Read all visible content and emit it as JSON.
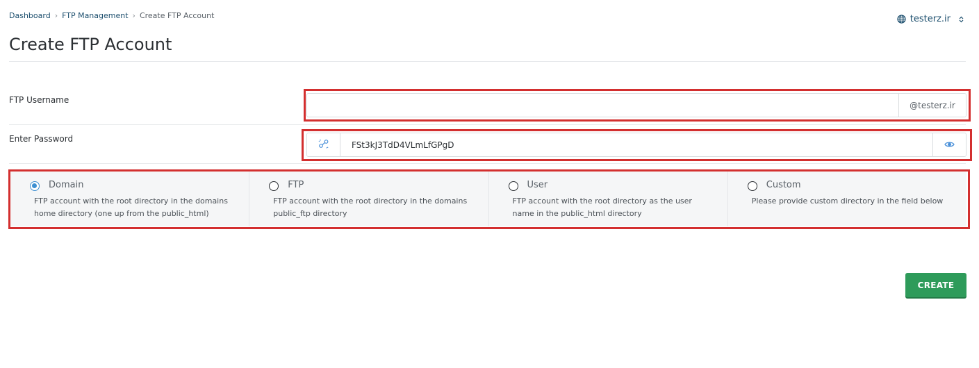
{
  "breadcrumb": {
    "items": [
      "Dashboard",
      "FTP Management"
    ],
    "current": "Create FTP Account"
  },
  "domain_switch": {
    "label": "testerz.ir",
    "icon": "globe-icon"
  },
  "page_title": "Create FTP Account",
  "form": {
    "username_label": "FTP Username",
    "username_value": "",
    "username_suffix": "@testerz.ir",
    "password_label": "Enter Password",
    "password_value": "FSt3kJ3TdD4VLmLfGPgD",
    "generate_icon": "generate-password-icon",
    "toggle_icon": "eye-icon"
  },
  "directory_options": [
    {
      "title": "Domain",
      "description": "FTP account with the root directory in the domains home directory (one up from the public_html)",
      "selected": true
    },
    {
      "title": "FTP",
      "description": "FTP account with the root directory in the domains public_ftp directory",
      "selected": false
    },
    {
      "title": "User",
      "description": "FTP account with the root directory as the user name in the public_html directory",
      "selected": false
    },
    {
      "title": "Custom",
      "description": "Please provide custom directory in the field below",
      "selected": false
    }
  ],
  "actions": {
    "create_label": "CREATE"
  },
  "colors": {
    "accent": "#2e9b5a",
    "highlight": "#d32f2f",
    "radio_selected": "#3d8fd1",
    "link": "#1d4f6e"
  }
}
